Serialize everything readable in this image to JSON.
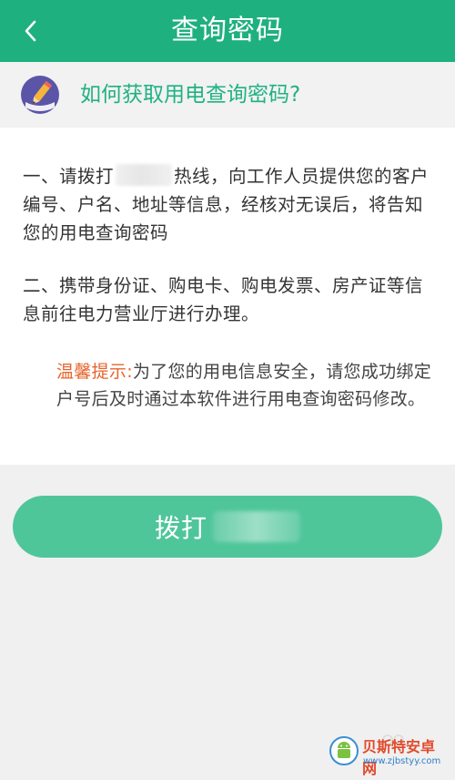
{
  "header": {
    "back_icon": "chevron-left-icon",
    "title": "查询密码",
    "color": "#1fb07f"
  },
  "question": {
    "icon": "pencil-icon",
    "text": "如何获取用电查询密码?",
    "color": "#21b183"
  },
  "content": {
    "para1_before": "一、请拨打",
    "para1_after": "热线，向工作人员提供您的客户编号、户名、地址等信息，经核对无误后，将告知您的用电查询密码",
    "para2": "二、携带身份证、购电卡、购电发票、房产证等信息前往电力营业厅进行办理。",
    "tip_label": "温馨提示:",
    "tip_text": "为了您的用电信息安全，请您成功绑定户号后及时通过本软件进行用电查询密码修改。",
    "tip_label_color": "#e6642c"
  },
  "call_button": {
    "label": "拨打",
    "color": "#4fc69a"
  },
  "watermark": {
    "name": "贝斯特安卓网",
    "url": "www.zjbstyy.com"
  }
}
